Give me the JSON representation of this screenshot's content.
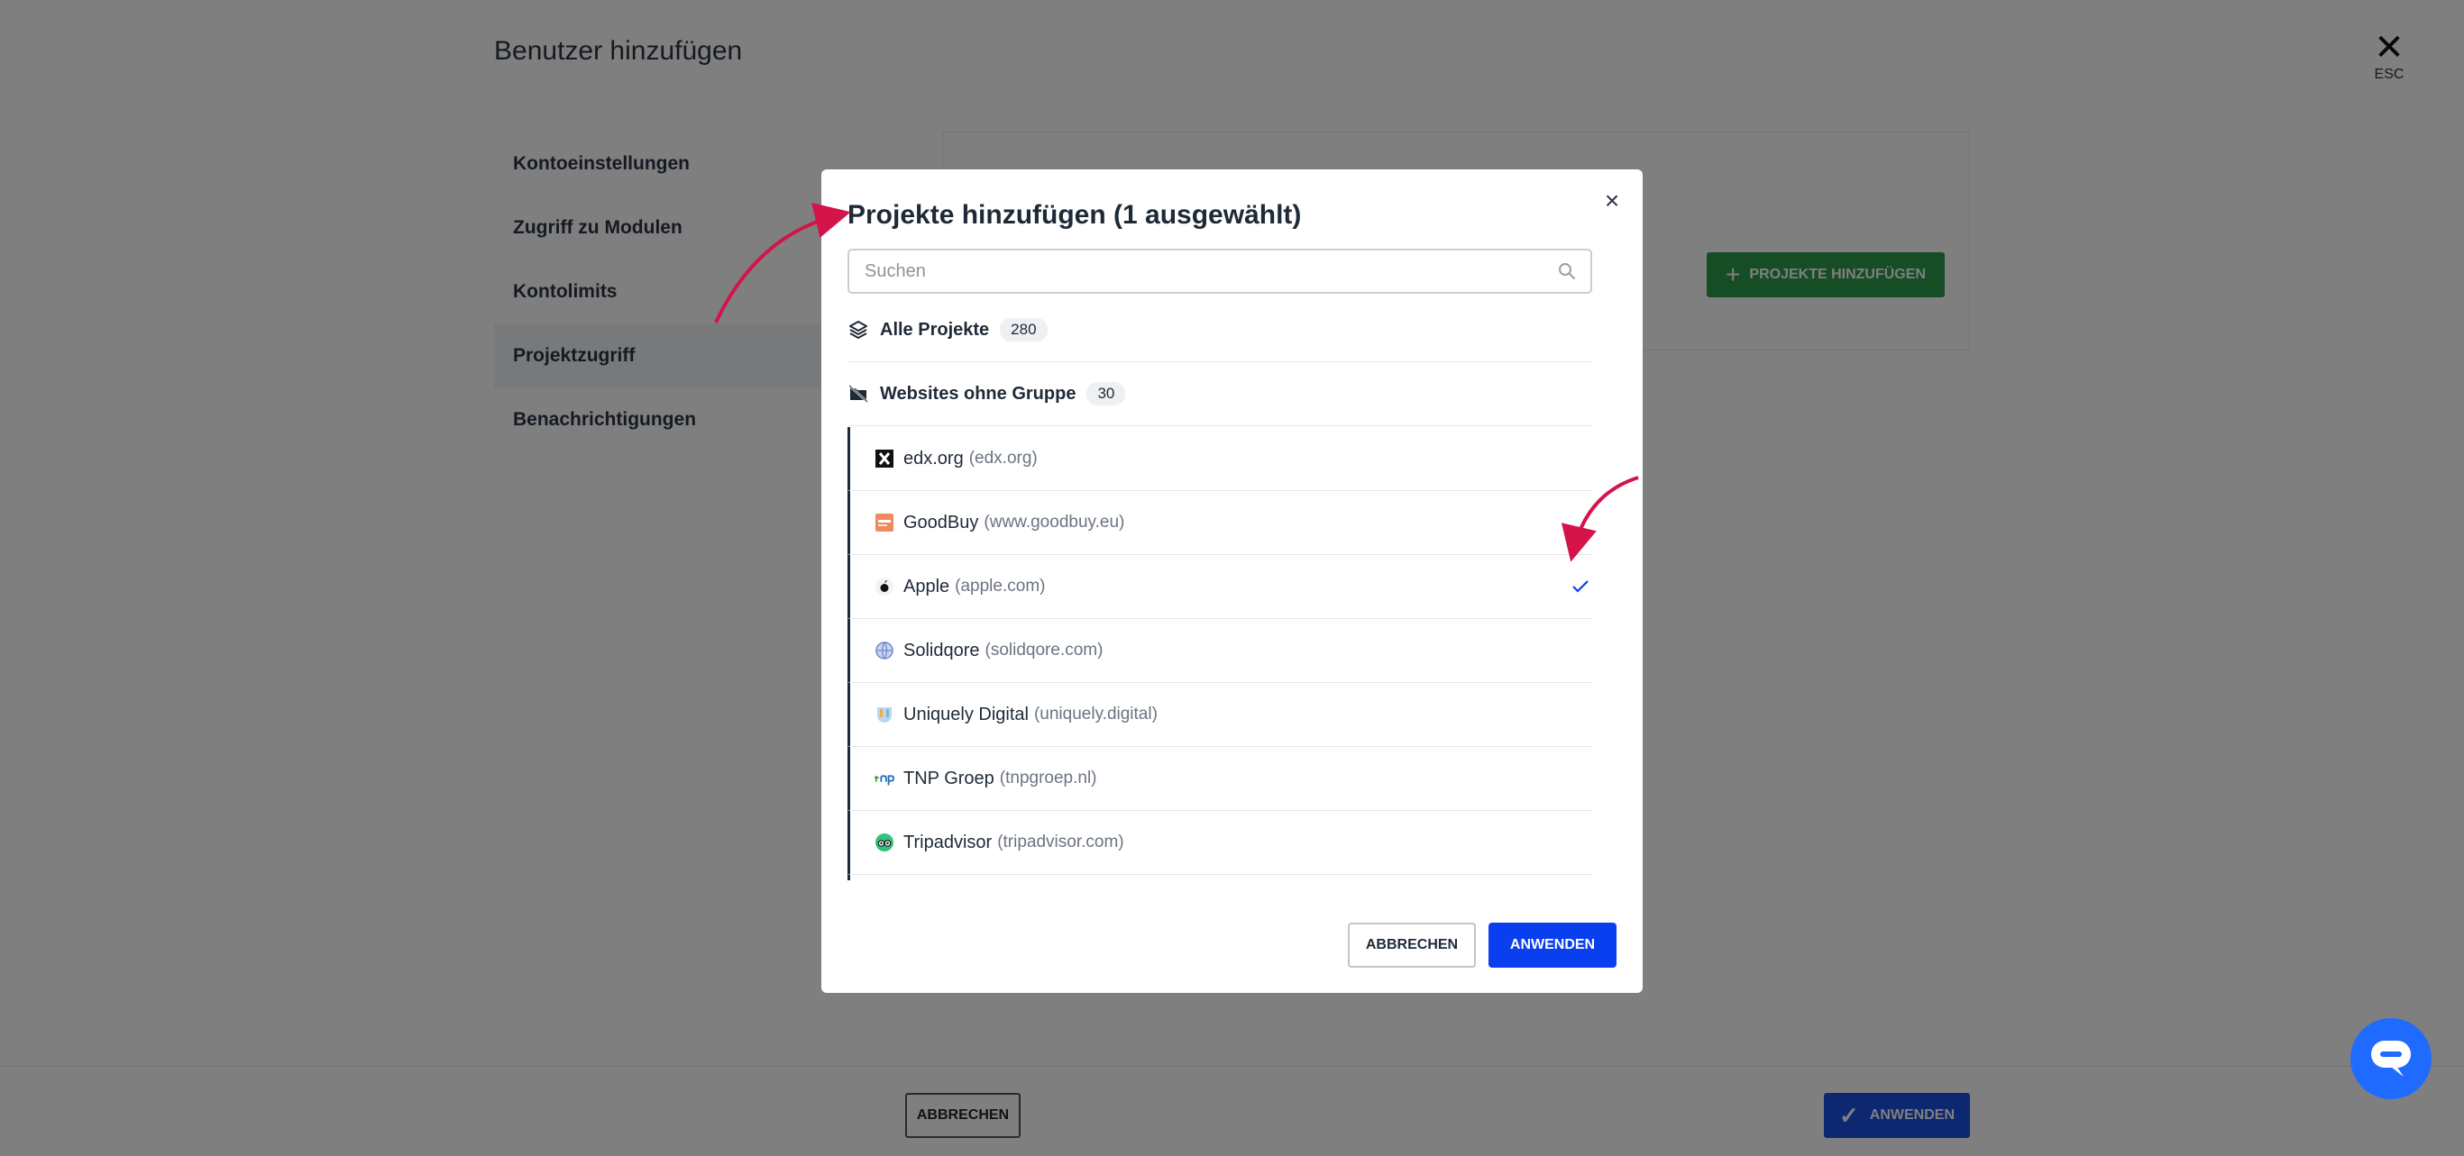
{
  "page": {
    "title": "Benutzer hinzufügen",
    "esc_label": "ESC",
    "nav": [
      {
        "label": "Kontoeinstellungen"
      },
      {
        "label": "Zugriff zu Modulen"
      },
      {
        "label": "Kontolimits"
      },
      {
        "label": "Projektzugriff"
      },
      {
        "label": "Benachrichtigungen"
      }
    ],
    "add_projects_button": "PROJEKTE HINZUFÜGEN",
    "footer": {
      "cancel": "ABBRECHEN",
      "apply": "ANWENDEN"
    }
  },
  "modal": {
    "title": "Projekte hinzufügen (1 ausgewählt)",
    "search_placeholder": "Suchen",
    "all_projects": {
      "label": "Alle Projekte",
      "count": "280"
    },
    "ungrouped": {
      "label": "Websites ohne Gruppe",
      "count": "30"
    },
    "items": [
      {
        "name": "edx.org",
        "domain": "(edx.org)",
        "icon": "edx-logo-icon",
        "selected": false
      },
      {
        "name": "GoodBuy",
        "domain": "(www.goodbuy.eu)",
        "icon": "goodbuy-logo-icon",
        "selected": false
      },
      {
        "name": "Apple",
        "domain": "(apple.com)",
        "icon": "apple-logo-icon",
        "selected": true
      },
      {
        "name": "Solidqore",
        "domain": "(solidqore.com)",
        "icon": "globe-icon",
        "selected": false
      },
      {
        "name": "Uniquely Digital",
        "domain": "(uniquely.digital)",
        "icon": "uniquely-logo-icon",
        "selected": false
      },
      {
        "name": "TNP Groep",
        "domain": "(tnpgroep.nl)",
        "icon": "tnp-logo-icon",
        "selected": false
      },
      {
        "name": "Tripadvisor",
        "domain": "(tripadvisor.com)",
        "icon": "tripadvisor-logo-icon",
        "selected": false
      }
    ],
    "cancel": "ABBRECHEN",
    "apply": "ANWENDEN"
  },
  "colors": {
    "accent_blue": "#0a3ff0",
    "annotation_arrow": "#d3144a",
    "green_button": "#2f9a4a"
  }
}
